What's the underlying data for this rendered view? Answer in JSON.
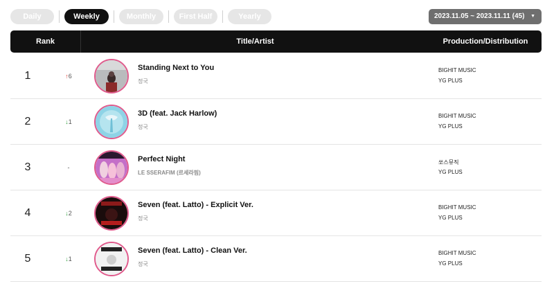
{
  "tabs": [
    {
      "label": "Daily",
      "active": false
    },
    {
      "label": "Weekly",
      "active": true
    },
    {
      "label": "Monthly",
      "active": false
    },
    {
      "label": "First Half",
      "active": false
    },
    {
      "label": "Yearly",
      "active": false
    }
  ],
  "date_selector": {
    "value": "2023.11.05 ~ 2023.11.11 (45)"
  },
  "table": {
    "headers": {
      "rank": "Rank",
      "title": "Title/Artist",
      "production": "Production/Distribution"
    },
    "rows": [
      {
        "rank": "1",
        "change": "6",
        "direction": "up",
        "title": "Standing Next to You",
        "artist": "정국",
        "production": "BIGHIT MUSIC",
        "distribution": "YG PLUS"
      },
      {
        "rank": "2",
        "change": "1",
        "direction": "down",
        "title": "3D (feat. Jack Harlow)",
        "artist": "정국",
        "production": "BIGHIT MUSIC",
        "distribution": "YG PLUS"
      },
      {
        "rank": "3",
        "change": "-",
        "direction": "same",
        "title": "Perfect Night",
        "artist": "LE SSERAFIM (르세라핌)",
        "production": "쏘스뮤직",
        "distribution": "YG PLUS"
      },
      {
        "rank": "4",
        "change": "2",
        "direction": "down",
        "title": "Seven (feat. Latto) - Explicit Ver.",
        "artist": "정국",
        "production": "BIGHIT MUSIC",
        "distribution": "YG PLUS"
      },
      {
        "rank": "5",
        "change": "1",
        "direction": "down",
        "title": "Seven (feat. Latto) - Clean Ver.",
        "artist": "정국",
        "production": "BIGHIT MUSIC",
        "distribution": "YG PLUS"
      }
    ]
  },
  "colors": {
    "header_bg": "#111111",
    "up": "#e0423a",
    "down": "#2e9e3e",
    "cover_ring": "#e05a8c"
  }
}
